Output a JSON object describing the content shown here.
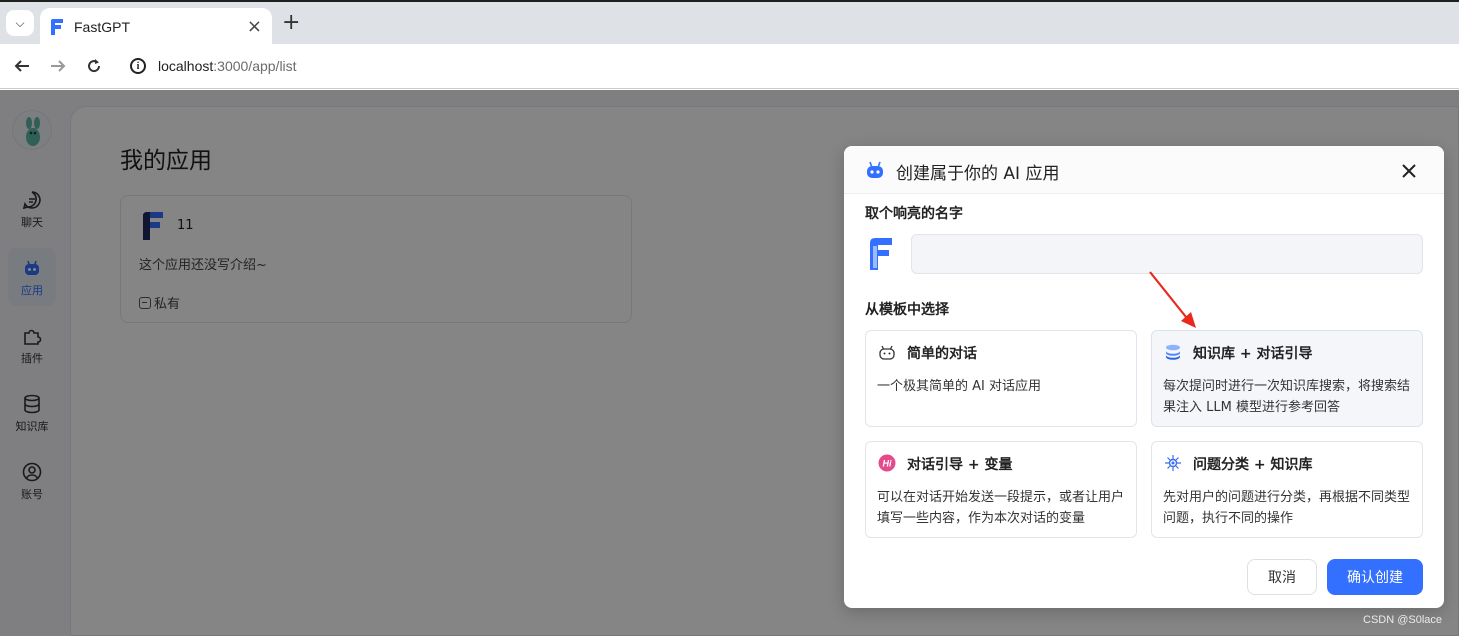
{
  "browser": {
    "tab_title": "FastGPT",
    "url_host": "localhost",
    "url_path": ":3000/app/list",
    "icons": {
      "tab_menu": "chevron-down-icon",
      "close": "close-icon",
      "new_tab": "plus-icon",
      "back": "arrow-left-icon",
      "forward": "arrow-right-icon",
      "reload": "reload-icon",
      "site_info": "info-icon"
    }
  },
  "sidebar": {
    "items": [
      {
        "label": "聊天",
        "icon": "chat-icon",
        "active": false
      },
      {
        "label": "应用",
        "icon": "robot-icon",
        "active": true
      },
      {
        "label": "插件",
        "icon": "puzzle-icon",
        "active": false
      },
      {
        "label": "知识库",
        "icon": "database-icon",
        "active": false
      },
      {
        "label": "账号",
        "icon": "user-icon",
        "active": false
      }
    ]
  },
  "main": {
    "title": "我的应用",
    "app_card": {
      "name": "11",
      "intro": "这个应用还没写介绍~",
      "visibility": "私有"
    }
  },
  "modal": {
    "title": "创建属于你的 AI 应用",
    "name_label": "取个响亮的名字",
    "name_value": "",
    "template_label": "从模板中选择",
    "templates": [
      {
        "title": "简单的对话",
        "desc": "一个极其简单的 AI 对话应用",
        "icon": "bot-face-icon",
        "selected": false
      },
      {
        "title": "知识库 + 对话引导",
        "desc": "每次提问时进行一次知识库搜索，将搜索结果注入 LLM 模型进行参考回答",
        "icon": "database-stack-icon",
        "selected": true
      },
      {
        "title": "对话引导 + 变量",
        "desc": "可以在对话开始发送一段提示，或者让用户填写一些内容，作为本次对话的变量",
        "icon": "hi-badge-icon",
        "selected": false
      },
      {
        "title": "问题分类 + 知识库",
        "desc": "先对用户的问题进行分类，再根据不同类型问题，执行不同的操作",
        "icon": "sparkle-icon",
        "selected": false
      }
    ],
    "cancel_label": "取消",
    "confirm_label": "确认创建"
  },
  "watermark": "CSDN @S0lace",
  "colors": {
    "accent": "#3370ff",
    "annotation_arrow": "#e8291c"
  }
}
